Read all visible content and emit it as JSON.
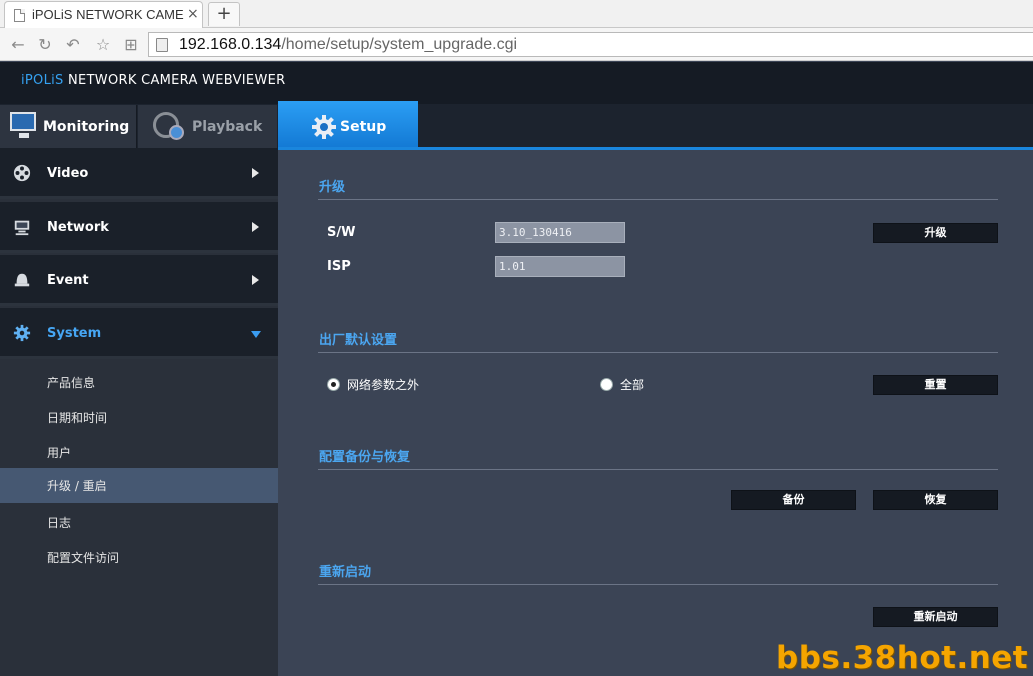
{
  "browser": {
    "tab_title": "iPOLiS NETWORK CAMERA",
    "tab_close": "×",
    "new_tab": "+",
    "url_host": "192.168.0.134",
    "url_path": "/home/setup/system_upgrade.cgi"
  },
  "header": {
    "brand_prefix": "iPOLiS",
    "brand_rest": " NETWORK CAMERA WEBVIEWER"
  },
  "main_tabs": {
    "monitoring": "Monitoring",
    "playback": "Playback",
    "setup": "Setup"
  },
  "sidebar": {
    "sections": {
      "video": "Video",
      "network": "Network",
      "event": "Event",
      "system": "System"
    },
    "system_items": [
      "产品信息",
      "日期和时间",
      "用户",
      "升级 / 重启",
      "日志",
      "配置文件访问"
    ],
    "active_item": "升级 / 重启"
  },
  "content": {
    "upgrade": {
      "title": "升级",
      "sw_label": "S/W",
      "sw_value": "3.10_130416",
      "isp_label": "ISP",
      "isp_value": "1.01",
      "upgrade_button": "升级"
    },
    "factory": {
      "title": "出厂默认设置",
      "option_except_network": "网络参数之外",
      "option_all": "全部",
      "selected": "网络参数之外",
      "reset_button": "重置"
    },
    "backup": {
      "title": "配置备份与恢复",
      "backup_button": "备份",
      "restore_button": "恢复"
    },
    "restart": {
      "title": "重新启动",
      "restart_button": "重新启动"
    }
  },
  "watermark": "bbs.38hot.net",
  "colors": {
    "accent": "#1a86dd",
    "section_title": "#4ba6f0",
    "active_submenu": "#465872",
    "watermark": "#f5a500"
  }
}
